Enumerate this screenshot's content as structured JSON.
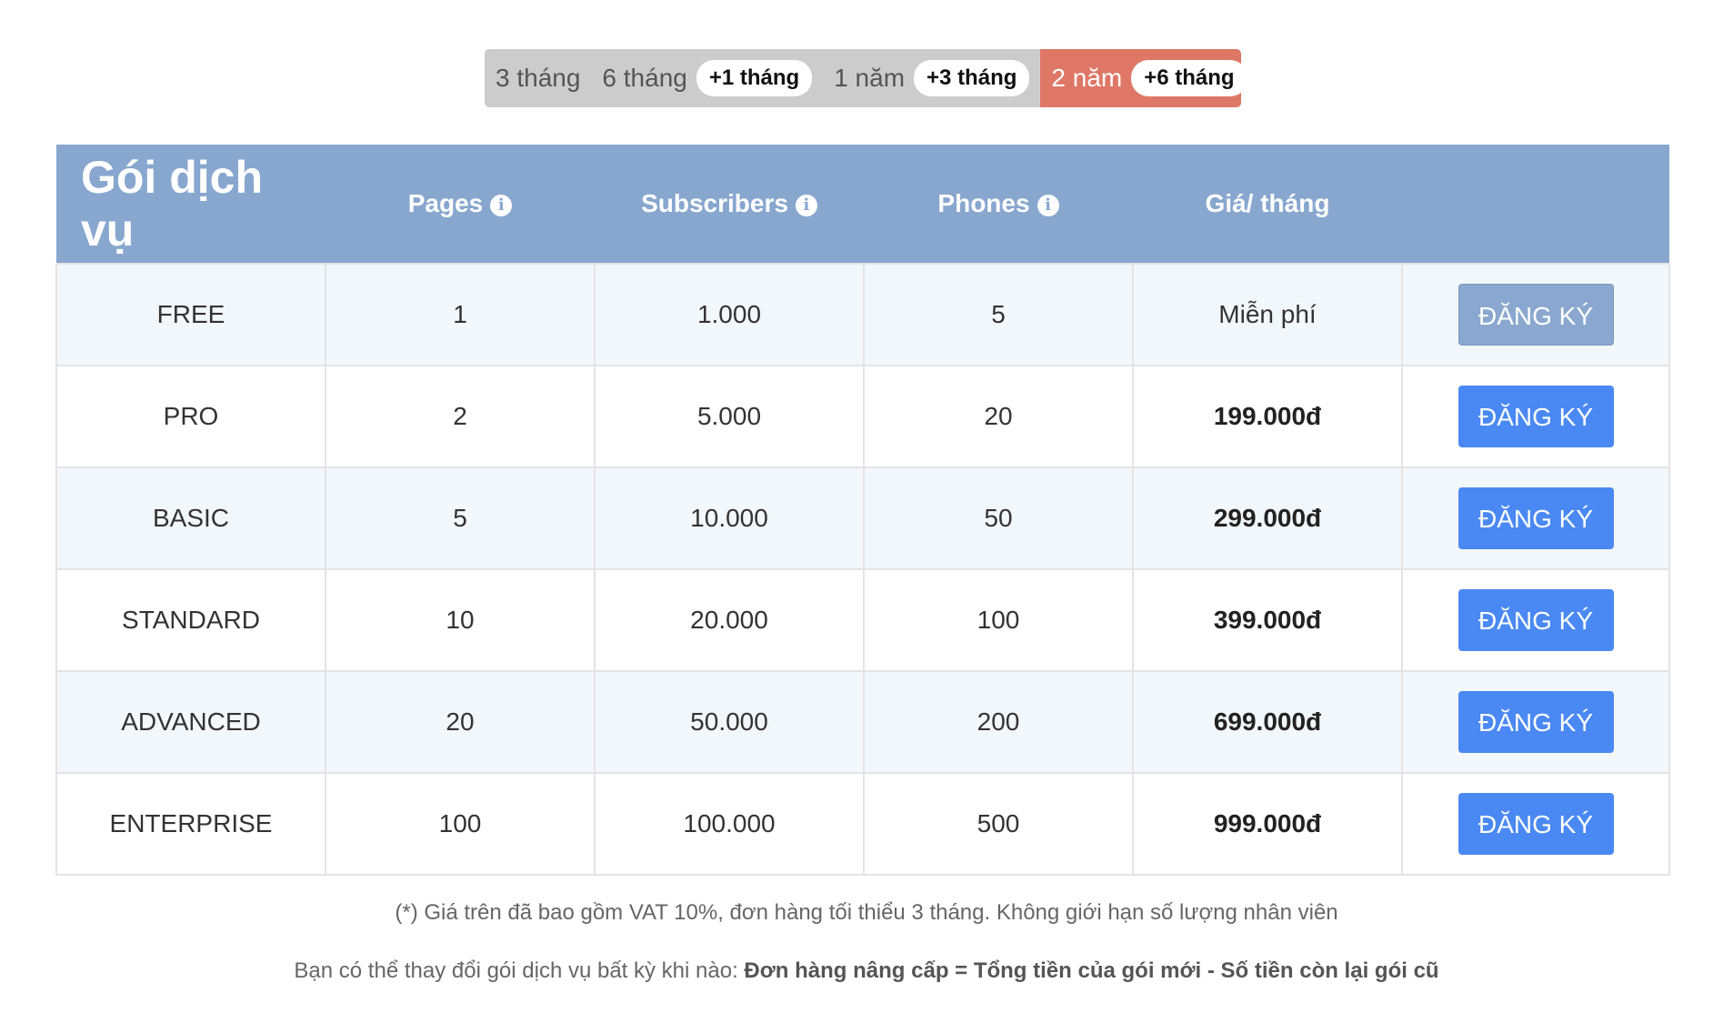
{
  "periods": [
    {
      "label": "3 tháng",
      "bonus": ""
    },
    {
      "label": "6 tháng",
      "bonus": "+1 tháng"
    },
    {
      "label": "1 năm",
      "bonus": "+3 tháng"
    },
    {
      "label": "2 năm",
      "bonus": "+6 tháng",
      "active": true
    }
  ],
  "table": {
    "headers": {
      "title": "Gói dịch vụ",
      "pages": "Pages",
      "subscribers": "Subscribers",
      "phones": "Phones",
      "price": "Giá/ tháng"
    },
    "rows": [
      {
        "name": "FREE",
        "pages": "1",
        "subscribers": "1.000",
        "phones": "5",
        "price": "Miễn phí",
        "button": "ĐĂNG KÝ"
      },
      {
        "name": "PRO",
        "pages": "2",
        "subscribers": "5.000",
        "phones": "20",
        "price": "199.000đ",
        "button": "ĐĂNG KÝ"
      },
      {
        "name": "BASIC",
        "pages": "5",
        "subscribers": "10.000",
        "phones": "50",
        "price": "299.000đ",
        "button": "ĐĂNG KÝ"
      },
      {
        "name": "STANDARD",
        "pages": "10",
        "subscribers": "20.000",
        "phones": "100",
        "price": "399.000đ",
        "button": "ĐĂNG KÝ"
      },
      {
        "name": "ADVANCED",
        "pages": "20",
        "subscribers": "50.000",
        "phones": "200",
        "price": "699.000đ",
        "button": "ĐĂNG KÝ"
      },
      {
        "name": "ENTERPRISE",
        "pages": "100",
        "subscribers": "100.000",
        "phones": "500",
        "price": "999.000đ",
        "button": "ĐĂNG KÝ"
      }
    ]
  },
  "notes": {
    "vat_note": "(*) Giá trên đã bao gồm VAT 10%, đơn hàng tối thiểu 3 tháng. Không giới hạn số lượng nhân viên",
    "upgrade_prefix": "Bạn có thể thay đổi gói dịch vụ bất kỳ khi nào: ",
    "upgrade_formula": "Đơn hàng nâng cấp = Tổng tiền của gói mới - Số tiền còn lại gói cũ"
  },
  "colors": {
    "header_bg": "#88a7cf",
    "active_period": "#de7766",
    "button": "#4a89f3"
  }
}
